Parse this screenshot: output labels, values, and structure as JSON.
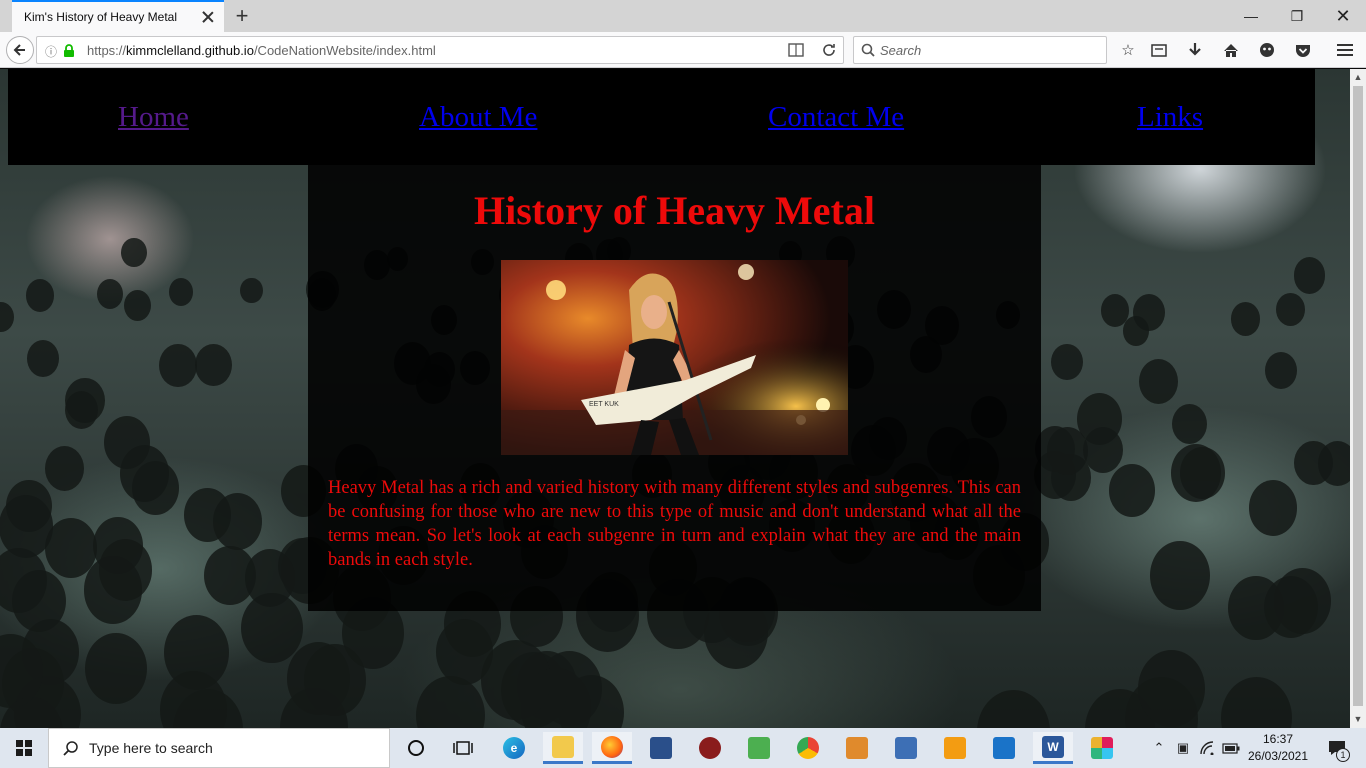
{
  "browser": {
    "tab_title": "Kim's History of Heavy Metal",
    "url_prefix": "https://",
    "url_host": "kimmclelland.github.io",
    "url_path": "/CodeNationWebsite/index.html",
    "search_placeholder": "Search"
  },
  "site_nav": {
    "items": [
      {
        "label": "Home"
      },
      {
        "label": "About Me"
      },
      {
        "label": "Contact Me"
      },
      {
        "label": "Links"
      }
    ]
  },
  "main": {
    "heading": "History of Heavy Metal",
    "intro": "Heavy Metal has a rich and varied history with many different styles and subgenres. This can be confusing for those who are new to this type of music and don't understand what all the terms mean. So let's look at each subgenre in turn and explain what they are and the main bands in each style."
  },
  "taskbar": {
    "search_placeholder": "Type here to search",
    "time": "16:37",
    "date": "26/03/2021",
    "notification_count": "1"
  },
  "colors": {
    "heading": "#ee0a0a",
    "link": "#0000ee",
    "visited_link": "#551a8b",
    "nav_bg": "#000000"
  }
}
